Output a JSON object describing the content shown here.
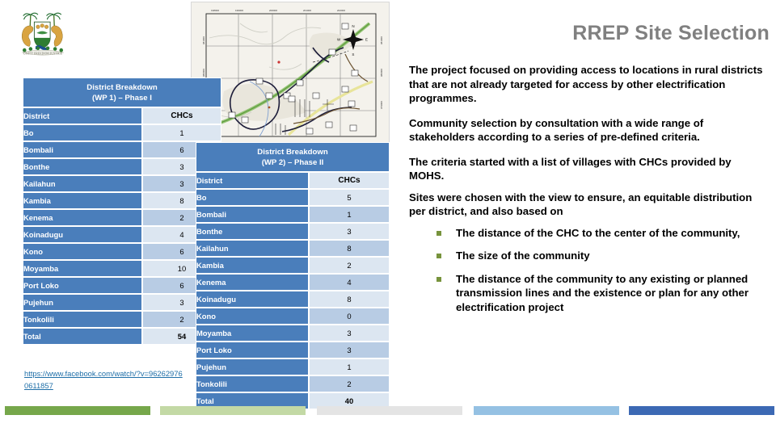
{
  "slide": {
    "title": "RREP Site Selection",
    "logo_alt": "sierra-leone-coat-of-arms",
    "map_alt": "site-survey-map"
  },
  "body": {
    "paragraphs": [
      "The project focused on providing access to locations in rural districts that are not already targeted for access by other electrification programmes.",
      "Community selection by consultation with a wide range of stakeholders according to a series of pre-defined criteria.",
      "The criteria started with a list of villages with CHCs provided by MOHS.",
      "Sites were chosen with the view to ensure, an equitable distribution per district, and also based on"
    ],
    "bullets": [
      "The distance of the CHC  to the center of the community,",
      "The size of the community",
      "The distance of the community to any existing or planned transmission lines and the existence or plan for any other electrification project"
    ],
    "bullet_color": "#77933c"
  },
  "link": {
    "text": "https://www.facebook.com/watch/?v=962629760611857",
    "color": "#1f6fa8"
  },
  "table1": {
    "title_line1": "District Breakdown",
    "title_line2": "(WP 1) – Phase I",
    "columns": [
      "District",
      "CHCs"
    ],
    "rows": [
      {
        "district": "Bo",
        "chcs": "1"
      },
      {
        "district": "Bombali",
        "chcs": "6"
      },
      {
        "district": "Bonthe",
        "chcs": "3"
      },
      {
        "district": "Kailahun",
        "chcs": "3"
      },
      {
        "district": "Kambia",
        "chcs": "8"
      },
      {
        "district": "Kenema",
        "chcs": "2"
      },
      {
        "district": "Koinadugu",
        "chcs": "4"
      },
      {
        "district": "Kono",
        "chcs": "6"
      },
      {
        "district": "Moyamba",
        "chcs": "10"
      },
      {
        "district": "Port Loko",
        "chcs": "6"
      },
      {
        "district": "Pujehun",
        "chcs": "3"
      },
      {
        "district": "Tonkolili",
        "chcs": "2"
      }
    ],
    "total_label": "Total",
    "total_value": "54"
  },
  "table2": {
    "title_line1": "District Breakdown",
    "title_line2": "(WP 2) – Phase II",
    "columns": [
      "District",
      "CHCs"
    ],
    "rows": [
      {
        "district": "Bo",
        "chcs": "5"
      },
      {
        "district": "Bombali",
        "chcs": "1"
      },
      {
        "district": "Bonthe",
        "chcs": "3"
      },
      {
        "district": "Kailahun",
        "chcs": "8"
      },
      {
        "district": "Kambia",
        "chcs": "2"
      },
      {
        "district": "Kenema",
        "chcs": "4"
      },
      {
        "district": "Koinadugu",
        "chcs": "8"
      },
      {
        "district": "Kono",
        "chcs": "0"
      },
      {
        "district": "Moyamba",
        "chcs": "3"
      },
      {
        "district": "Port Loko",
        "chcs": "3"
      },
      {
        "district": "Pujehun",
        "chcs": "1"
      },
      {
        "district": "Tonkolili",
        "chcs": "2"
      }
    ],
    "total_label": "Total",
    "total_value": "40"
  },
  "footer_bars": [
    {
      "name": "bar-green",
      "color": "#76a74b"
    },
    {
      "name": "bar-light-green",
      "color": "#c3d9a5"
    },
    {
      "name": "bar-gray",
      "color": "#e4e4e4"
    },
    {
      "name": "bar-light-blue",
      "color": "#95c1e3"
    },
    {
      "name": "bar-blue",
      "color": "#3c69b4"
    }
  ],
  "theme": {
    "table_header_blue": "#4a7ebb",
    "row_light": "#dce6f1",
    "row_dark": "#b8cce4",
    "title_gray": "#808080"
  }
}
